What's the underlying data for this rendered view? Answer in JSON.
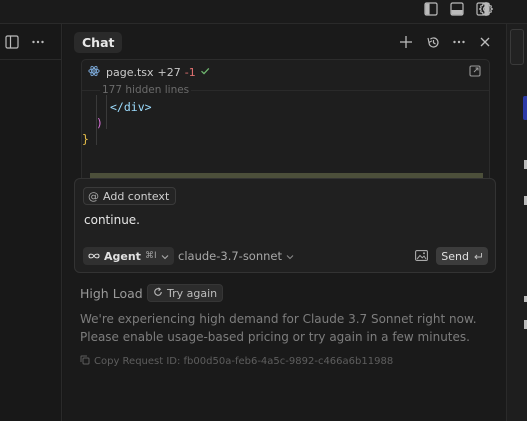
{
  "chat": {
    "title": "Chat"
  },
  "diff": {
    "file_name": "page.tsx",
    "additions": "+27",
    "deletions": "-1",
    "hidden_lines": "177 hidden lines",
    "code_lines": [
      "</div>",
      ")",
      "}"
    ]
  },
  "input": {
    "add_context_label": "Add context",
    "message": "continue.",
    "agent_label": "Agent",
    "agent_shortcut": "⌘I",
    "model": "claude-3.7-sonnet",
    "send_label": "Send"
  },
  "error": {
    "title": "High Load",
    "try_again_label": "Try again",
    "body": "We're experiencing high demand for Claude 3.7 Sonnet right now. Please enable usage-based pricing or try again in a few minutes.",
    "request_id": "Copy Request ID: fb00d50a-feb6-4a5c-9892-c466a6b11988"
  },
  "colors": {
    "background": "#181818",
    "panel": "#1a1a1a",
    "diff_deletion": "#e07070",
    "diff_accept": "#6fb56f",
    "code_tag": "#9cdcfe",
    "code_paren": "#d670d6",
    "code_brace": "#e8c04a"
  }
}
